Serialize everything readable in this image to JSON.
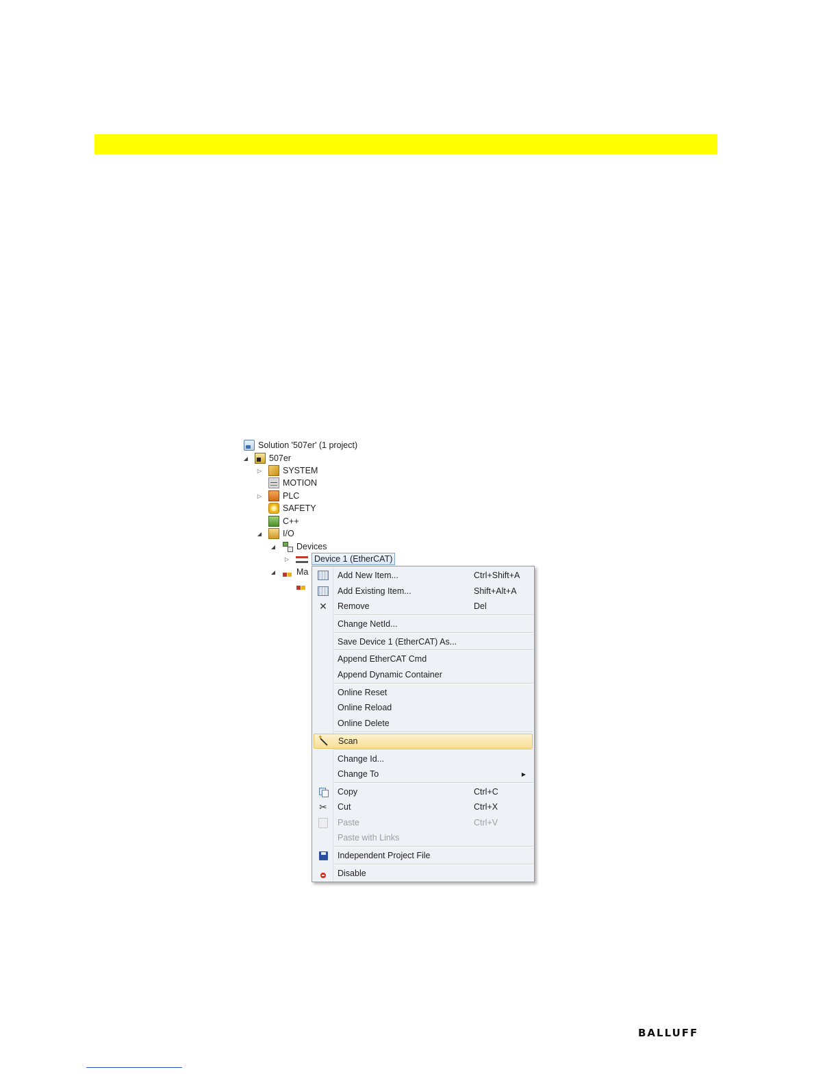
{
  "tree": {
    "solution": "Solution '507er' (1 project)",
    "project": "507er",
    "system": "SYSTEM",
    "motion": "MOTION",
    "plc": "PLC",
    "safety": "SAFETY",
    "cpp": "C++",
    "io": "I/O",
    "devices": "Devices",
    "device1": "Device 1 (EtherCAT)",
    "mappings_partial": "Ma"
  },
  "context_menu": {
    "add_new_item": {
      "label": "Add New Item...",
      "shortcut": "Ctrl+Shift+A"
    },
    "add_existing_item": {
      "label": "Add Existing Item...",
      "shortcut": "Shift+Alt+A"
    },
    "remove": {
      "label": "Remove",
      "shortcut": "Del"
    },
    "change_netid": {
      "label": "Change NetId..."
    },
    "save_device_as": {
      "label": "Save Device 1 (EtherCAT) As..."
    },
    "append_ethercat_cmd": {
      "label": "Append EtherCAT Cmd"
    },
    "append_dynamic_container": {
      "label": "Append Dynamic Container"
    },
    "online_reset": {
      "label": "Online Reset"
    },
    "online_reload": {
      "label": "Online Reload"
    },
    "online_delete": {
      "label": "Online Delete"
    },
    "scan": {
      "label": "Scan"
    },
    "change_id": {
      "label": "Change Id..."
    },
    "change_to": {
      "label": "Change To"
    },
    "copy": {
      "label": "Copy",
      "shortcut": "Ctrl+C"
    },
    "cut": {
      "label": "Cut",
      "shortcut": "Ctrl+X"
    },
    "paste": {
      "label": "Paste",
      "shortcut": "Ctrl+V"
    },
    "paste_with_links": {
      "label": "Paste with Links"
    },
    "independent_project_file": {
      "label": "Independent Project File"
    },
    "disable": {
      "label": "Disable"
    }
  },
  "footer": {
    "logo_text": "BALLUFF"
  },
  "colors": {
    "highlight": "#ffff00",
    "menu_background": "#eef1f6",
    "menu_hover": "#f8df96"
  }
}
